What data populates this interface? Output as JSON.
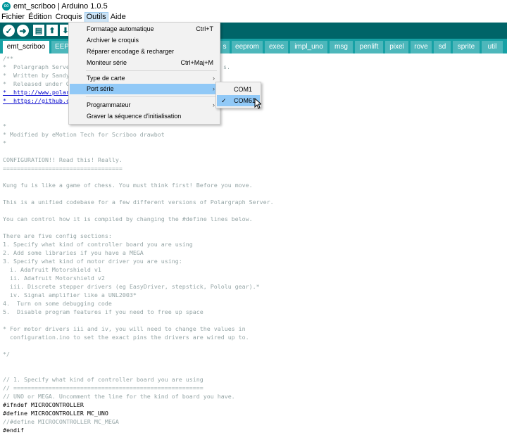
{
  "window": {
    "title": "emt_scriboo | Arduino 1.0.5",
    "app_icon": "arduino-icon"
  },
  "menubar": {
    "items": [
      "Fichier",
      "Édition",
      "Croquis",
      "Outils",
      "Aide"
    ],
    "active": "Outils"
  },
  "toolbar": {
    "buttons": [
      "verify-icon",
      "upload-icon",
      "new-icon",
      "open-icon",
      "save-icon"
    ]
  },
  "tabs": [
    "emt_scriboo",
    "EEP",
    "s",
    "eeprom",
    "exec",
    "impl_uno",
    "msg",
    "penlift",
    "pixel",
    "rove",
    "sd",
    "sprite",
    "util"
  ],
  "active_tab": "emt_scriboo",
  "outils_menu": {
    "items": [
      {
        "label": "Formatage automatique",
        "shortcut": "Ctrl+T"
      },
      {
        "label": "Archiver le croquis",
        "shortcut": ""
      },
      {
        "label": "Réparer encodage & recharger",
        "shortcut": ""
      },
      {
        "label": "Moniteur série",
        "shortcut": "Ctrl+Maj+M"
      },
      {
        "label": "Type de carte",
        "submenu": true
      },
      {
        "label": "Port série",
        "submenu": true,
        "highlighted": true
      },
      {
        "label": "Programmateur",
        "submenu": true
      },
      {
        "label": "Graver la séquence d'initialisation"
      }
    ]
  },
  "port_submenu": {
    "items": [
      "COM1",
      "COM61"
    ],
    "checked": "COM61"
  },
  "code_lines": [
    "/**",
    "*  Polargraph Serve",
    "*  Written by Sandy",
    "*  Released under G",
    "*  http://www.polar",
    "*  https://github.c",
    "",
    "*",
    "* Modified by eMotion Tech for Scriboo drawbot",
    "*",
    "",
    "CONFIGURATION!! Read this! Really.",
    "==================================",
    "",
    "Kung fu is like a game of chess. You must think first! Before you move.",
    "",
    "This is a unified codebase for a few different versions of Polargraph Server.",
    "",
    "You can control how it is compiled by changing the #define lines below.",
    "",
    "There are five config sections:",
    "1. Specify what kind of controller board you are using",
    "2. Add some libraries if you have a MEGA",
    "3. Specify what kind of motor driver you are using:",
    "  i. Adafruit Motorshield v1",
    "  ii. Adafruit Motorshield v2",
    "  iii. Discrete stepper drivers (eg EasyDriver, stepstick, Pololu gear).*",
    "  iv. Signal amplifier like a UNL2003*",
    "4.  Turn on some debugging code",
    "5.  Disable program features if you need to free up space",
    "",
    "* For motor drivers iii and iv, you will need to change the values in",
    "  configuration.ino to set the exact pins the drivers are wired up to.",
    "",
    "*/",
    "",
    "",
    "// 1. Specify what kind of controller board you are using",
    "// ======================================================",
    "// UNO or MEGA. Uncomment the line for the kind of board you have.",
    "#ifndef MICROCONTROLLER",
    "#define MICROCONTROLLER MC_UNO",
    "//#define MICROCONTROLLER MC_MEGA",
    "#endif"
  ],
  "code_tail_fragment": "s."
}
